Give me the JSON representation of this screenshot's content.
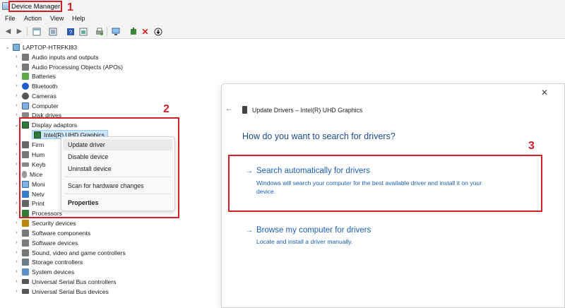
{
  "window": {
    "title": "Device Manager"
  },
  "menu": [
    "File",
    "Action",
    "View",
    "Help"
  ],
  "toolbar": {
    "icons": [
      "back-arrow-icon",
      "forward-arrow-icon",
      "properties-icon",
      "show-hidden-icon",
      "help-icon",
      "view-icon",
      "print-icon",
      "scan-hardware-icon",
      "add-driver-icon",
      "uninstall-icon",
      "update-icon"
    ]
  },
  "tree": {
    "root": "LAPTOP-HTRFKI83",
    "categories": [
      "Audio inputs and outputs",
      "Audio Processing Objects (APOs)",
      "Batteries",
      "Bluetooth",
      "Cameras",
      "Computer",
      "Disk drives",
      "Display adaptors",
      "Intel(R) UHD Graphics",
      "Firm",
      "Hum",
      "Keyb",
      "Mice",
      "Moni",
      "Netv",
      "Print",
      "Processors",
      "Security devices",
      "Software components",
      "Software devices",
      "Sound, video and game controllers",
      "Storage controllers",
      "System devices",
      "Universal Serial Bus controllers",
      "Universal Serial Bus devices"
    ]
  },
  "context_menu": {
    "items": [
      "Update driver",
      "Disable device",
      "Uninstall device",
      "Scan for hardware changes",
      "Properties"
    ]
  },
  "dialog": {
    "header": "Update Drivers – Intel(R) UHD Graphics",
    "question": "How do you want to search for drivers?",
    "option1": {
      "title": "Search automatically for drivers",
      "desc_line1": "Windows will search your computer for the best available driver and install it on your",
      "desc_line2": "device."
    },
    "option2": {
      "title": "Browse my computer for drivers",
      "desc": "Locate and install a driver manually."
    },
    "back_icon": "back-arrow-icon",
    "close_icon": "close-icon"
  },
  "annotations": {
    "step1": "1",
    "step2": "2",
    "step3": "3"
  },
  "colors": {
    "annotation_red": "#d0202a",
    "link_blue": "#1a5fb4",
    "selection": "#cce4f7"
  }
}
